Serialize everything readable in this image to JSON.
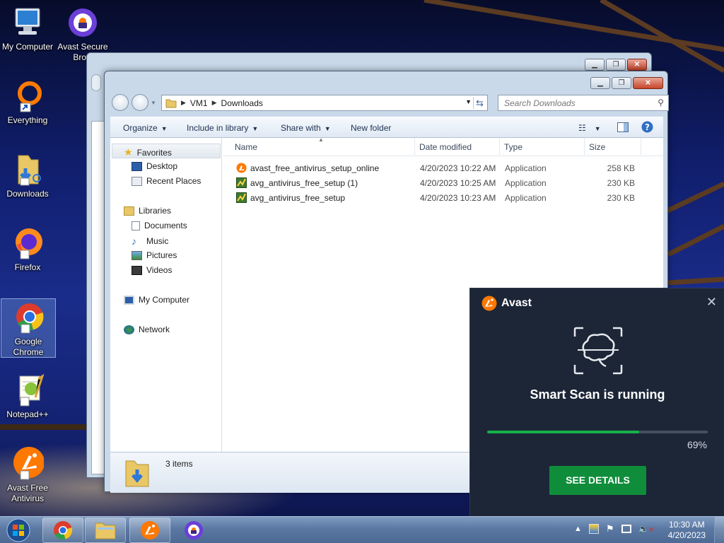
{
  "desktop": {
    "icons": [
      {
        "name": "My Computer",
        "icon": "computer-icon"
      },
      {
        "name": "Avast Secure Brow...",
        "line1": "Avast Secure",
        "line2": "Brow",
        "icon": "avast-secure-browser-icon"
      },
      {
        "name": "Everything",
        "icon": "everything-icon"
      },
      {
        "name": "Downloads",
        "icon": "folder-downloads-icon"
      },
      {
        "name": "Firefox",
        "icon": "firefox-icon"
      },
      {
        "name": "Google Chrome",
        "line1": "Google",
        "line2": "Chrome",
        "icon": "chrome-icon"
      },
      {
        "name": "Notepad++",
        "icon": "notepadpp-icon"
      },
      {
        "name": "Avast Free Antivirus",
        "line1": "Avast Free",
        "line2": "Antivirus",
        "icon": "avast-icon"
      }
    ]
  },
  "explorer": {
    "breadcrumb": [
      "VM1",
      "Downloads"
    ],
    "search_placeholder": "Search Downloads",
    "toolbar": {
      "organize": "Organize",
      "include": "Include in library",
      "share": "Share with",
      "new_folder": "New folder"
    },
    "nav": {
      "favorites": "Favorites",
      "desktop": "Desktop",
      "recent": "Recent Places",
      "libraries": "Libraries",
      "documents": "Documents",
      "music": "Music",
      "pictures": "Pictures",
      "videos": "Videos",
      "computer": "My Computer",
      "network": "Network"
    },
    "columns": {
      "name": "Name",
      "date": "Date modified",
      "type": "Type",
      "size": "Size"
    },
    "files": [
      {
        "name": "avast_free_antivirus_setup_online",
        "date": "4/20/2023 10:22 AM",
        "type": "Application",
        "size": "258 KB",
        "icon": "avast-setup-icon"
      },
      {
        "name": "avg_antivirus_free_setup (1)",
        "date": "4/20/2023 10:25 AM",
        "type": "Application",
        "size": "230 KB",
        "icon": "avg-setup-icon"
      },
      {
        "name": "avg_antivirus_free_setup",
        "date": "4/20/2023 10:23 AM",
        "type": "Application",
        "size": "230 KB",
        "icon": "avg-setup-icon"
      }
    ],
    "item_count": "3 items"
  },
  "avast_popup": {
    "brand": "Avast",
    "title": "Smart Scan is running",
    "progress": 0.69,
    "progress_text": "69%",
    "button": "SEE DETAILS"
  },
  "taskbar": {
    "time": "10:30 AM",
    "date": "4/20/2023"
  },
  "colors": {
    "avast_orange": "#ff7800",
    "avast_green": "#108d3b",
    "progress_green": "#16b14a",
    "popup_bg": "#1c2637"
  }
}
